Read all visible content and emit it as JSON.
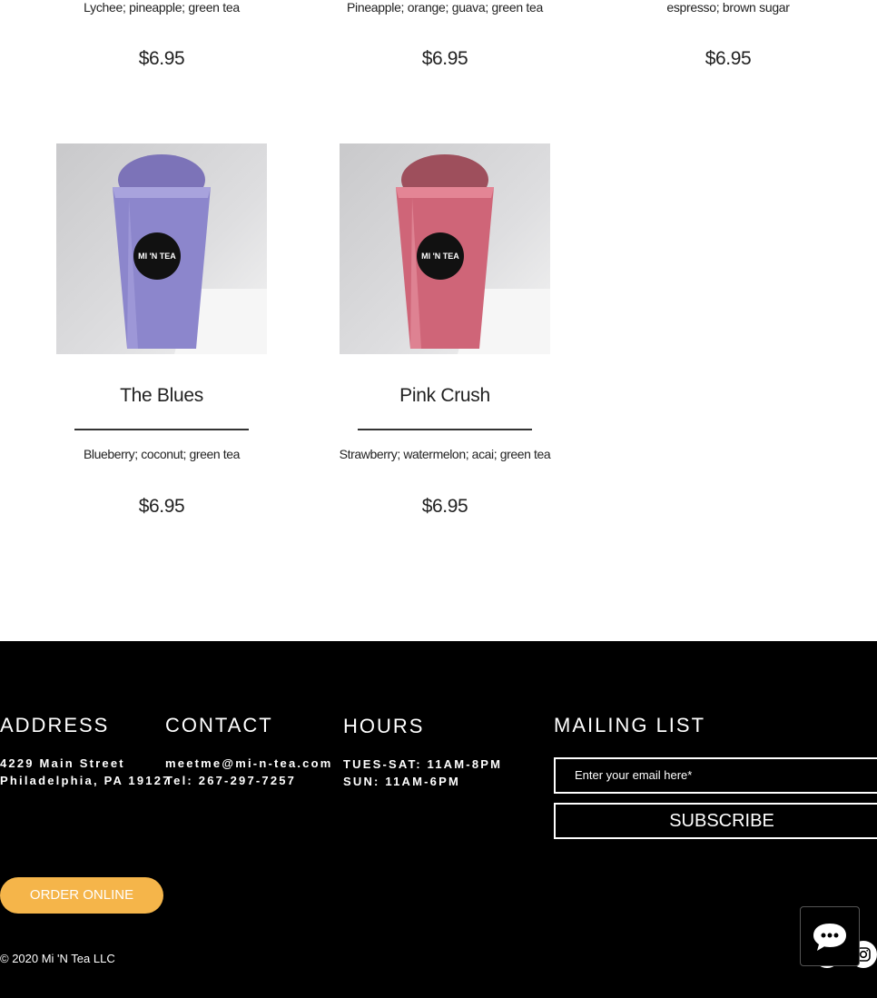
{
  "menu": {
    "top_row": [
      {
        "desc": "Lychee; pineapple; green tea",
        "price": "$6.95"
      },
      {
        "desc": "Pineapple; orange; guava; green tea",
        "price": "$6.95"
      },
      {
        "desc": "espresso; brown sugar",
        "price": "$6.95"
      }
    ],
    "items": [
      {
        "name": "The Blues",
        "desc": "Blueberry; coconut; green tea",
        "price": "$6.95",
        "cup_color": "#8c86cc",
        "cup_logo": "MI 'N TEA"
      },
      {
        "name": "Pink Crush",
        "desc": "Strawberry; watermelon; acai; green tea",
        "price": "$6.95",
        "cup_color": "#cf6578",
        "cup_logo": "MI 'N TEA"
      }
    ]
  },
  "footer": {
    "address": {
      "heading": "ADDRESS",
      "line1": "4229 Main Street",
      "line2": "Philadelphia, PA 19127"
    },
    "contact": {
      "heading": "CONTACT",
      "email": "meetme@mi-n-tea.com",
      "phone": "Tel: 267-297-7257"
    },
    "hours": {
      "heading": "HOURS",
      "line1": "TUES-SAT: 11AM-8PM",
      "line2": "SUN: 11AM-6PM"
    },
    "mailing": {
      "heading": "MAILING LIST",
      "placeholder": "Enter your email here*",
      "subscribe_label": "SUBSCRIBE"
    },
    "order_label": "ORDER ONLINE",
    "copyright": "© 2020 Mi 'N Tea LLC",
    "icons": {
      "chat": "chat-bubble-icon",
      "instagram": "instagram-icon",
      "facebook": "facebook-icon"
    }
  },
  "colors": {
    "order_button": "#f5b54a",
    "footer_bg": "#000000"
  }
}
